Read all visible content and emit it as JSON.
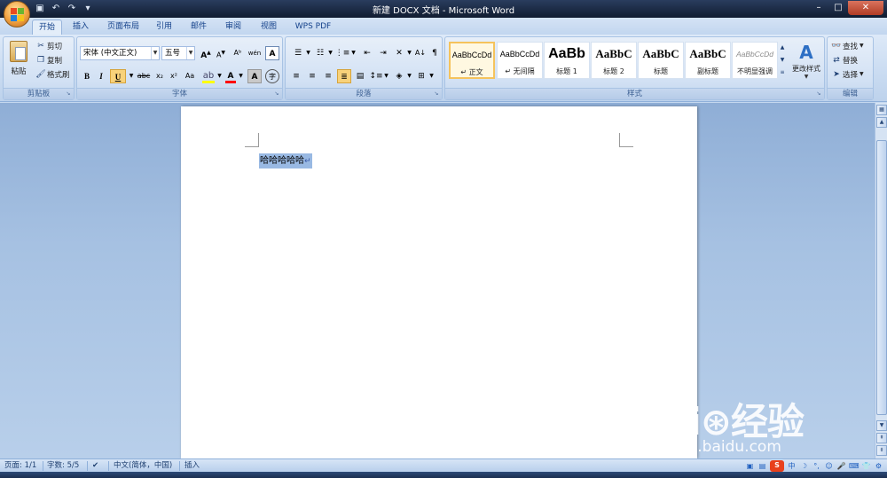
{
  "window": {
    "title": "新建 DOCX 文档 - Microsoft Word",
    "controls": {
      "minimize": "–",
      "maximize": "□",
      "close": "✕"
    }
  },
  "quick_access": [
    {
      "icon": "save-icon",
      "glyph": "▣"
    },
    {
      "icon": "undo-icon",
      "glyph": "↶"
    },
    {
      "icon": "redo-icon",
      "glyph": "↷"
    },
    {
      "icon": "customize-icon",
      "glyph": "▾"
    }
  ],
  "tabs": [
    "开始",
    "插入",
    "页面布局",
    "引用",
    "邮件",
    "审阅",
    "视图",
    "WPS PDF"
  ],
  "ribbon": {
    "clipboard": {
      "label": "剪贴板",
      "paste": "粘贴",
      "cut": "剪切",
      "copy": "复制",
      "format_painter": "格式刷"
    },
    "font": {
      "label": "字体",
      "font_name": "宋体 (中文正文)",
      "font_size": "五号",
      "grow": "A",
      "shrink": "A",
      "clear": "Aᵇ",
      "phonetic": "wén",
      "bold": "B",
      "italic": "I",
      "underline": "U",
      "strike": "abc",
      "subscript": "x₂",
      "superscript": "x²",
      "change_case": "Aa",
      "font_color": "A",
      "char_shade": "A",
      "enclose": "字"
    },
    "paragraph": {
      "label": "段落"
    },
    "styles": {
      "label": "样式",
      "items": [
        {
          "sample": "AaBbCcDd",
          "name": "↵ 正文"
        },
        {
          "sample": "AaBbCcDd",
          "name": "↵ 无间隔"
        },
        {
          "sample": "AaBb",
          "name": "标题 1"
        },
        {
          "sample": "AaBbC",
          "name": "标题 2"
        },
        {
          "sample": "AaBbC",
          "name": "标题"
        },
        {
          "sample": "AaBbC",
          "name": "副标题"
        },
        {
          "sample": "AaBbCcDd",
          "name": "不明显强调"
        }
      ],
      "change_styles": "更改样式"
    },
    "editing": {
      "label": "编辑",
      "find": "查找",
      "replace": "替换",
      "select": "选择"
    }
  },
  "document": {
    "text": "哈哈哈哈哈",
    "para_mark": "↵"
  },
  "status": {
    "page": "页面: 1/1",
    "words": "字数: 5/5",
    "language": "中文(简体，中国)",
    "mode": "插入"
  },
  "tray": [
    "中",
    "☽",
    "°,",
    "☺",
    "🎤",
    "⌨",
    "👕",
    "⚙"
  ],
  "watermark": {
    "brand": "Bai⊛经验",
    "url": "jingyan.baidu.com"
  },
  "colors": {
    "accent": "#15428b",
    "selection": "#99b9e3",
    "highlight_yellow": "#ffff00",
    "font_red": "#ff0000",
    "style_selected_border": "#f5c35c"
  }
}
